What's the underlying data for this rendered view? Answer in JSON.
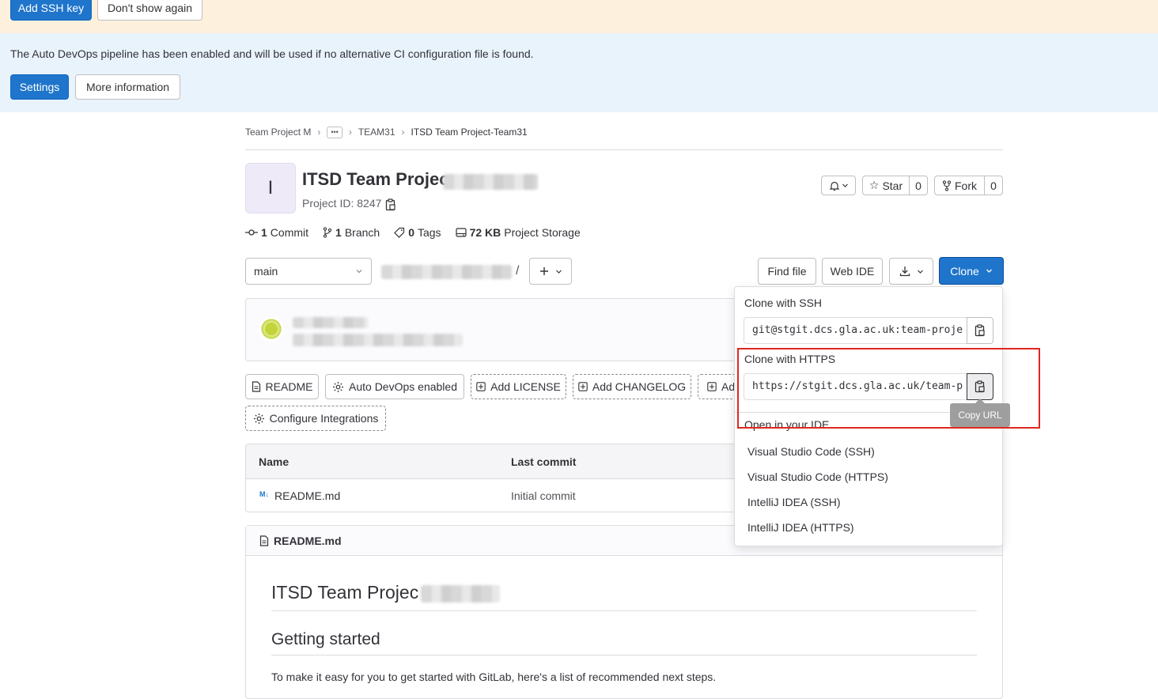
{
  "ssh_banner": {
    "add_ssh_key": "Add SSH key",
    "dont_show_again": "Don't show again"
  },
  "devops_banner": {
    "message": "The Auto DevOps pipeline has been enabled and will be used if no alternative CI configuration file is found.",
    "settings": "Settings",
    "more_info": "More information"
  },
  "breadcrumb": {
    "group": "Team Project M",
    "ellipsis": "•••",
    "subgroup": "TEAM31",
    "project": "ITSD Team Project-Team31"
  },
  "project": {
    "avatar_letter": "I",
    "title": "ITSD Team Projec",
    "project_id": "Project ID: 8247",
    "star_label": "Star",
    "star_count": "0",
    "fork_label": "Fork",
    "fork_count": "0"
  },
  "stats": {
    "commits_num": "1",
    "commits_label": "Commit",
    "branches_num": "1",
    "branches_label": "Branch",
    "tags_num": "0",
    "tags_label": "Tags",
    "storage_num": "72 KB",
    "storage_label": "Project Storage"
  },
  "toolbar": {
    "branch": "main",
    "path_sep": "/",
    "find_file": "Find file",
    "web_ide": "Web IDE",
    "clone": "Clone"
  },
  "quick_actions": {
    "readme": "README",
    "autodevops": "Auto DevOps enabled",
    "add_license": "Add LICENSE",
    "add_changelog": "Add CHANGELOG",
    "add_more": "Ad",
    "configure_integrations": "Configure Integrations"
  },
  "file_table": {
    "headers": [
      "Name",
      "Last commit"
    ],
    "rows": [
      {
        "name": "README.md",
        "last_commit": "Initial commit"
      }
    ]
  },
  "readme": {
    "header": "README.md",
    "title": "ITSD Team Projec",
    "getting_started": "Getting started",
    "intro": "To make it easy for you to get started with GitLab, here's a list of recommended next steps."
  },
  "clone_dropdown": {
    "ssh_heading": "Clone with SSH",
    "ssh_url": "git@stgit.dcs.gla.ac.uk:team-proje",
    "https_heading": "Clone with HTTPS",
    "https_url": "https://stgit.dcs.gla.ac.uk/team-p",
    "tooltip": "Copy URL",
    "ide_heading": "Open in your IDE",
    "ide_options": [
      "Visual Studio Code (SSH)",
      "Visual Studio Code (HTTPS)",
      "IntelliJ IDEA (SSH)",
      "IntelliJ IDEA (HTTPS)"
    ]
  },
  "colors": {
    "primary": "#1f75cb",
    "ssh_banner_bg": "#fdf1dd",
    "devops_banner_bg": "#e9f3fc",
    "highlight_box": "#e0281f",
    "tooltip_bg": "#9e9e9e"
  }
}
